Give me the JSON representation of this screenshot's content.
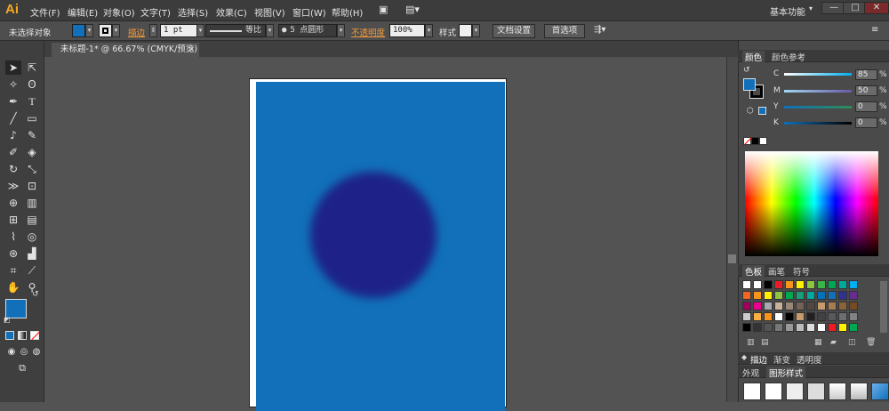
{
  "app": {
    "logo": "Ai"
  },
  "menu": [
    "文件(F)",
    "编辑(E)",
    "对象(O)",
    "文字(T)",
    "选择(S)",
    "效果(C)",
    "视图(V)",
    "窗口(W)",
    "帮助(H)"
  ],
  "workspace": {
    "label": "基本功能"
  },
  "window_controls": {
    "minimize": "—",
    "maximize": "□",
    "close": "✕"
  },
  "control_bar": {
    "selection": "未选择对象",
    "stroke_label": "描边",
    "stroke_weight": "1 pt",
    "line_style": "等比",
    "brush": "5 点圆形",
    "opacity_label": "不透明度",
    "opacity_value": "100%",
    "style_label": "样式",
    "doc_setup": "文档设置",
    "preferences": "首选项",
    "fill_color": "#1170b9"
  },
  "document": {
    "tab_title": "未标题-1* @ 66.67% (CMYK/预览)",
    "close": "✕"
  },
  "artwork": {
    "background": "#1170b9",
    "circle": "#1e2288"
  },
  "color_panel": {
    "tabs": [
      "颜色",
      "颜色参考"
    ],
    "channels": [
      {
        "label": "C",
        "value": "85",
        "unit": "%"
      },
      {
        "label": "M",
        "value": "50",
        "unit": "%"
      },
      {
        "label": "Y",
        "value": "0",
        "unit": "%"
      },
      {
        "label": "K",
        "value": "0",
        "unit": "%"
      }
    ]
  },
  "swatch_panel": {
    "tabs": [
      "色板",
      "画笔",
      "符号"
    ]
  },
  "bottom_panel": {
    "tabs": [
      "描边",
      "渐变",
      "透明度"
    ],
    "subtabs": [
      "外观",
      "图形样式"
    ]
  },
  "tool_fill": "#1170b9"
}
